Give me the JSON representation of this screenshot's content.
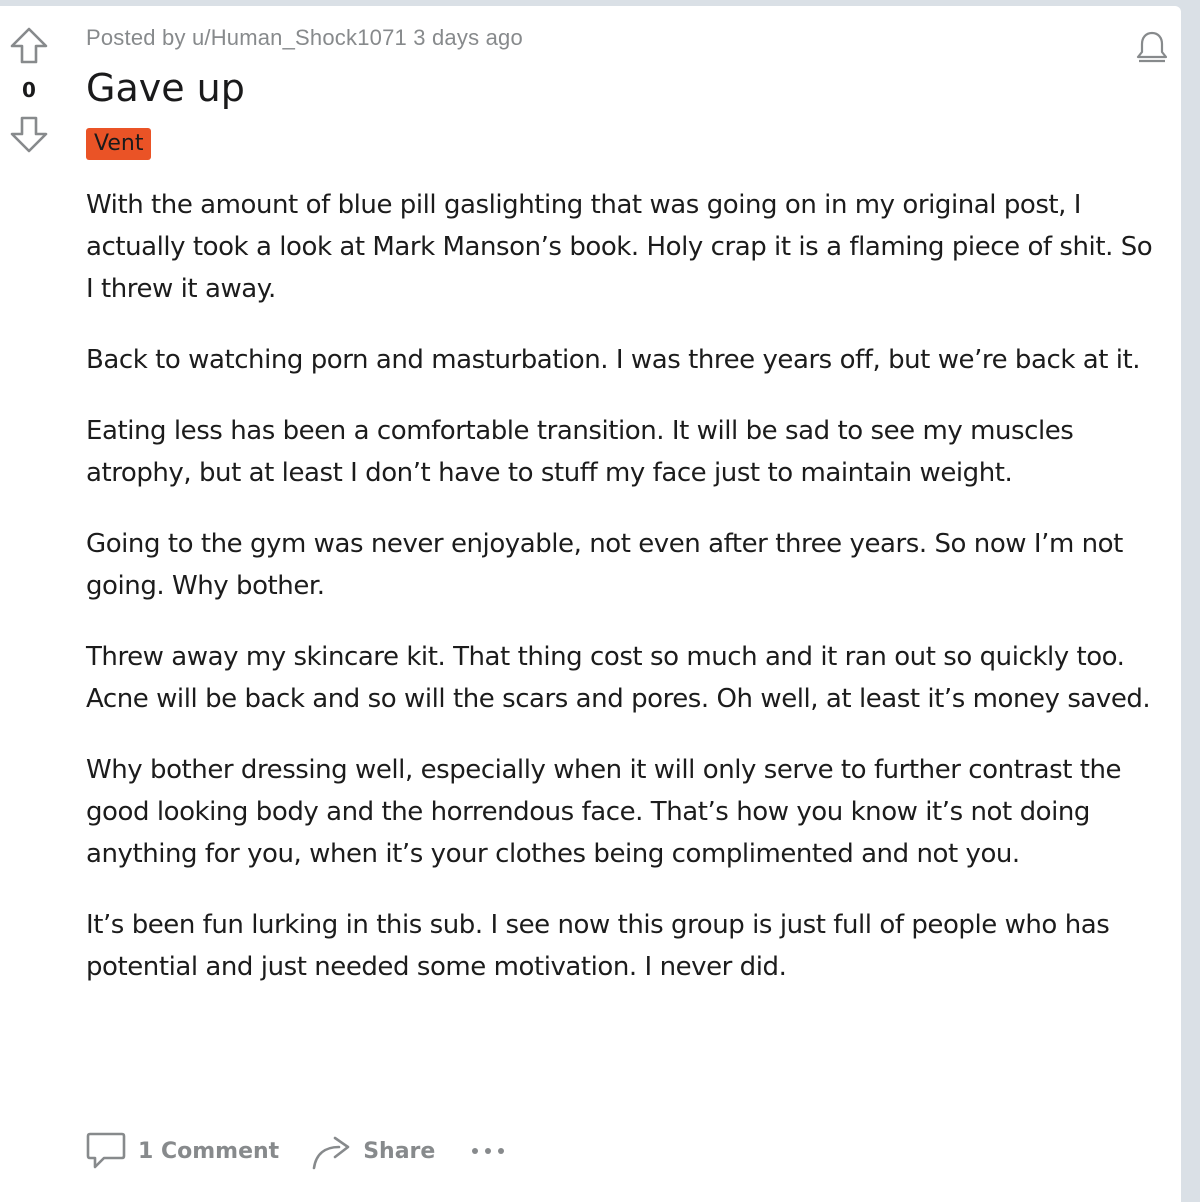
{
  "post": {
    "score": "0",
    "meta": "Posted by u/Human_Shock1071 3 days ago",
    "title": "Gave up",
    "flair": "Vent",
    "paragraphs": [
      "With the amount of blue pill gaslighting that was going on in my original post, I actually took a look at Mark Manson’s book. Holy crap it is a flaming piece of shit. So I threw it away.",
      "Back to watching porn and masturbation. I was three years off, but we’re back at it.",
      "Eating less has been a comfortable transition. It will be sad to see my muscles atrophy, but at least I don’t have to stuff my face just to maintain weight.",
      "Going to the gym was never enjoyable, not even after three years. So now I’m not going. Why bother.",
      "Threw away my skincare kit. That thing cost so much and it ran out so quickly too. Acne will be back and so will the scars and pores. Oh well, at least it’s money saved.",
      "Why bother dressing well, especially when it will only serve to further contrast the good looking body and the horrendous face. That’s how you know it’s not doing anything for you, when it’s your clothes being complimented and not you.",
      "It’s been fun lurking in this sub. I see now this group is just full of people who has potential and just needed some motivation. I never did."
    ]
  },
  "actions": {
    "comments_label": "1 Comment",
    "share_label": "Share"
  },
  "icons": {
    "upvote": "upvote-arrow-icon",
    "downvote": "downvote-arrow-icon",
    "bell": "bell-icon",
    "comment": "comment-bubble-icon",
    "share": "share-arrow-icon",
    "more": "more-dots-icon"
  },
  "colors": {
    "flair_bg": "#ea5326",
    "muted": "#878a8c",
    "background": "#dae0e6"
  }
}
